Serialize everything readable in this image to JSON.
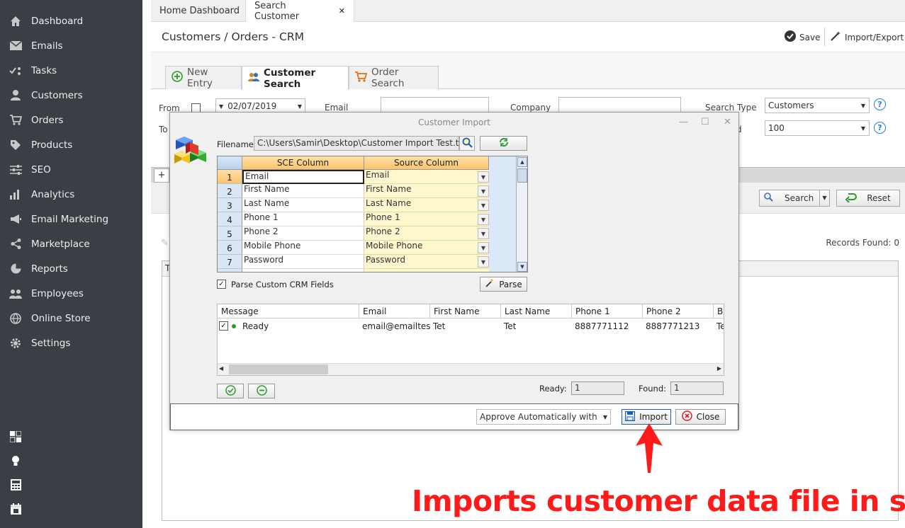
{
  "sidebar": {
    "items": [
      {
        "label": "Dashboard",
        "icon": "home-icon"
      },
      {
        "label": "Emails",
        "icon": "envelope-icon"
      },
      {
        "label": "Tasks",
        "icon": "tasks-icon"
      },
      {
        "label": "Customers",
        "icon": "user-icon"
      },
      {
        "label": "Orders",
        "icon": "cart-icon"
      },
      {
        "label": "Products",
        "icon": "tag-icon"
      },
      {
        "label": "SEO",
        "icon": "sliders-icon"
      },
      {
        "label": "Analytics",
        "icon": "bar-chart-icon"
      },
      {
        "label": "Email Marketing",
        "icon": "megaphone-icon"
      },
      {
        "label": "Marketplace",
        "icon": "share-icon"
      },
      {
        "label": "Reports",
        "icon": "pie-chart-icon"
      },
      {
        "label": "Employees",
        "icon": "users-icon"
      },
      {
        "label": "Online Store",
        "icon": "globe-icon"
      },
      {
        "label": "Settings",
        "icon": "gear-icon"
      }
    ]
  },
  "tabs": {
    "home": "Home Dashboard",
    "search": "Search Customer",
    "close": "✕"
  },
  "header": {
    "title": "Customers / Orders - CRM",
    "save": "Save",
    "import_export": "Import/Export"
  },
  "subtabs": {
    "new_entry": "New Entry",
    "customer_search": "Customer Search",
    "order_search": "Order Search"
  },
  "form": {
    "from_label": "From",
    "to_label": "To",
    "date_value": "02/07/2019",
    "email_label": "Email",
    "company_label": "Company",
    "search_type_label": "Search Type",
    "search_type_value": "Customers",
    "records_label": "d",
    "records_value": "100",
    "help": "?"
  },
  "search_bar": {
    "search_label": "Search",
    "reset_label": "Reset",
    "plus": "+"
  },
  "records_found": "Records Found: 0",
  "results_first_col": "T",
  "dialog": {
    "title": "Customer Import",
    "filename_label": "Filename",
    "filename_value": "C:\\Users\\Samir\\Desktop\\Customer Import Test.txt",
    "grid": {
      "sce_header": "SCE Column",
      "source_header": "Source Column",
      "rows": [
        {
          "num": "1",
          "sce": "Email",
          "source": "Email"
        },
        {
          "num": "2",
          "sce": "First Name",
          "source": "First Name"
        },
        {
          "num": "3",
          "sce": "Last Name",
          "source": "Last Name"
        },
        {
          "num": "4",
          "sce": "Phone 1",
          "source": "Phone 1"
        },
        {
          "num": "5",
          "sce": "Phone 2",
          "source": "Phone 2"
        },
        {
          "num": "6",
          "sce": "Mobile Phone",
          "source": "Mobile Phone"
        },
        {
          "num": "7",
          "sce": "Password",
          "source": "Password"
        }
      ]
    },
    "parse_custom_label": "Parse Custom CRM Fields",
    "parse_button": "Parse",
    "list": {
      "headers": [
        "Message",
        "Email",
        "First Name",
        "Last Name",
        "Phone 1",
        "Phone 2",
        "Bi"
      ],
      "row": [
        "Ready",
        "email@emailtest.…",
        "Tet",
        "Tet",
        "8887771112",
        "8887771213",
        "Te"
      ]
    },
    "ready_label": "Ready:",
    "ready_value": "1",
    "found_label": "Found:",
    "found_value": "1",
    "approve_select": "Approve Automatically with",
    "import_button": "Import",
    "close_button": "Close"
  },
  "annotation": "Imports customer data file in sce",
  "colors": {
    "sidebar_bg": "#3b3f45",
    "annotation_red": "#ff1a1a",
    "grid_header": "#fbc36b",
    "source_cell": "#fff8cf"
  }
}
